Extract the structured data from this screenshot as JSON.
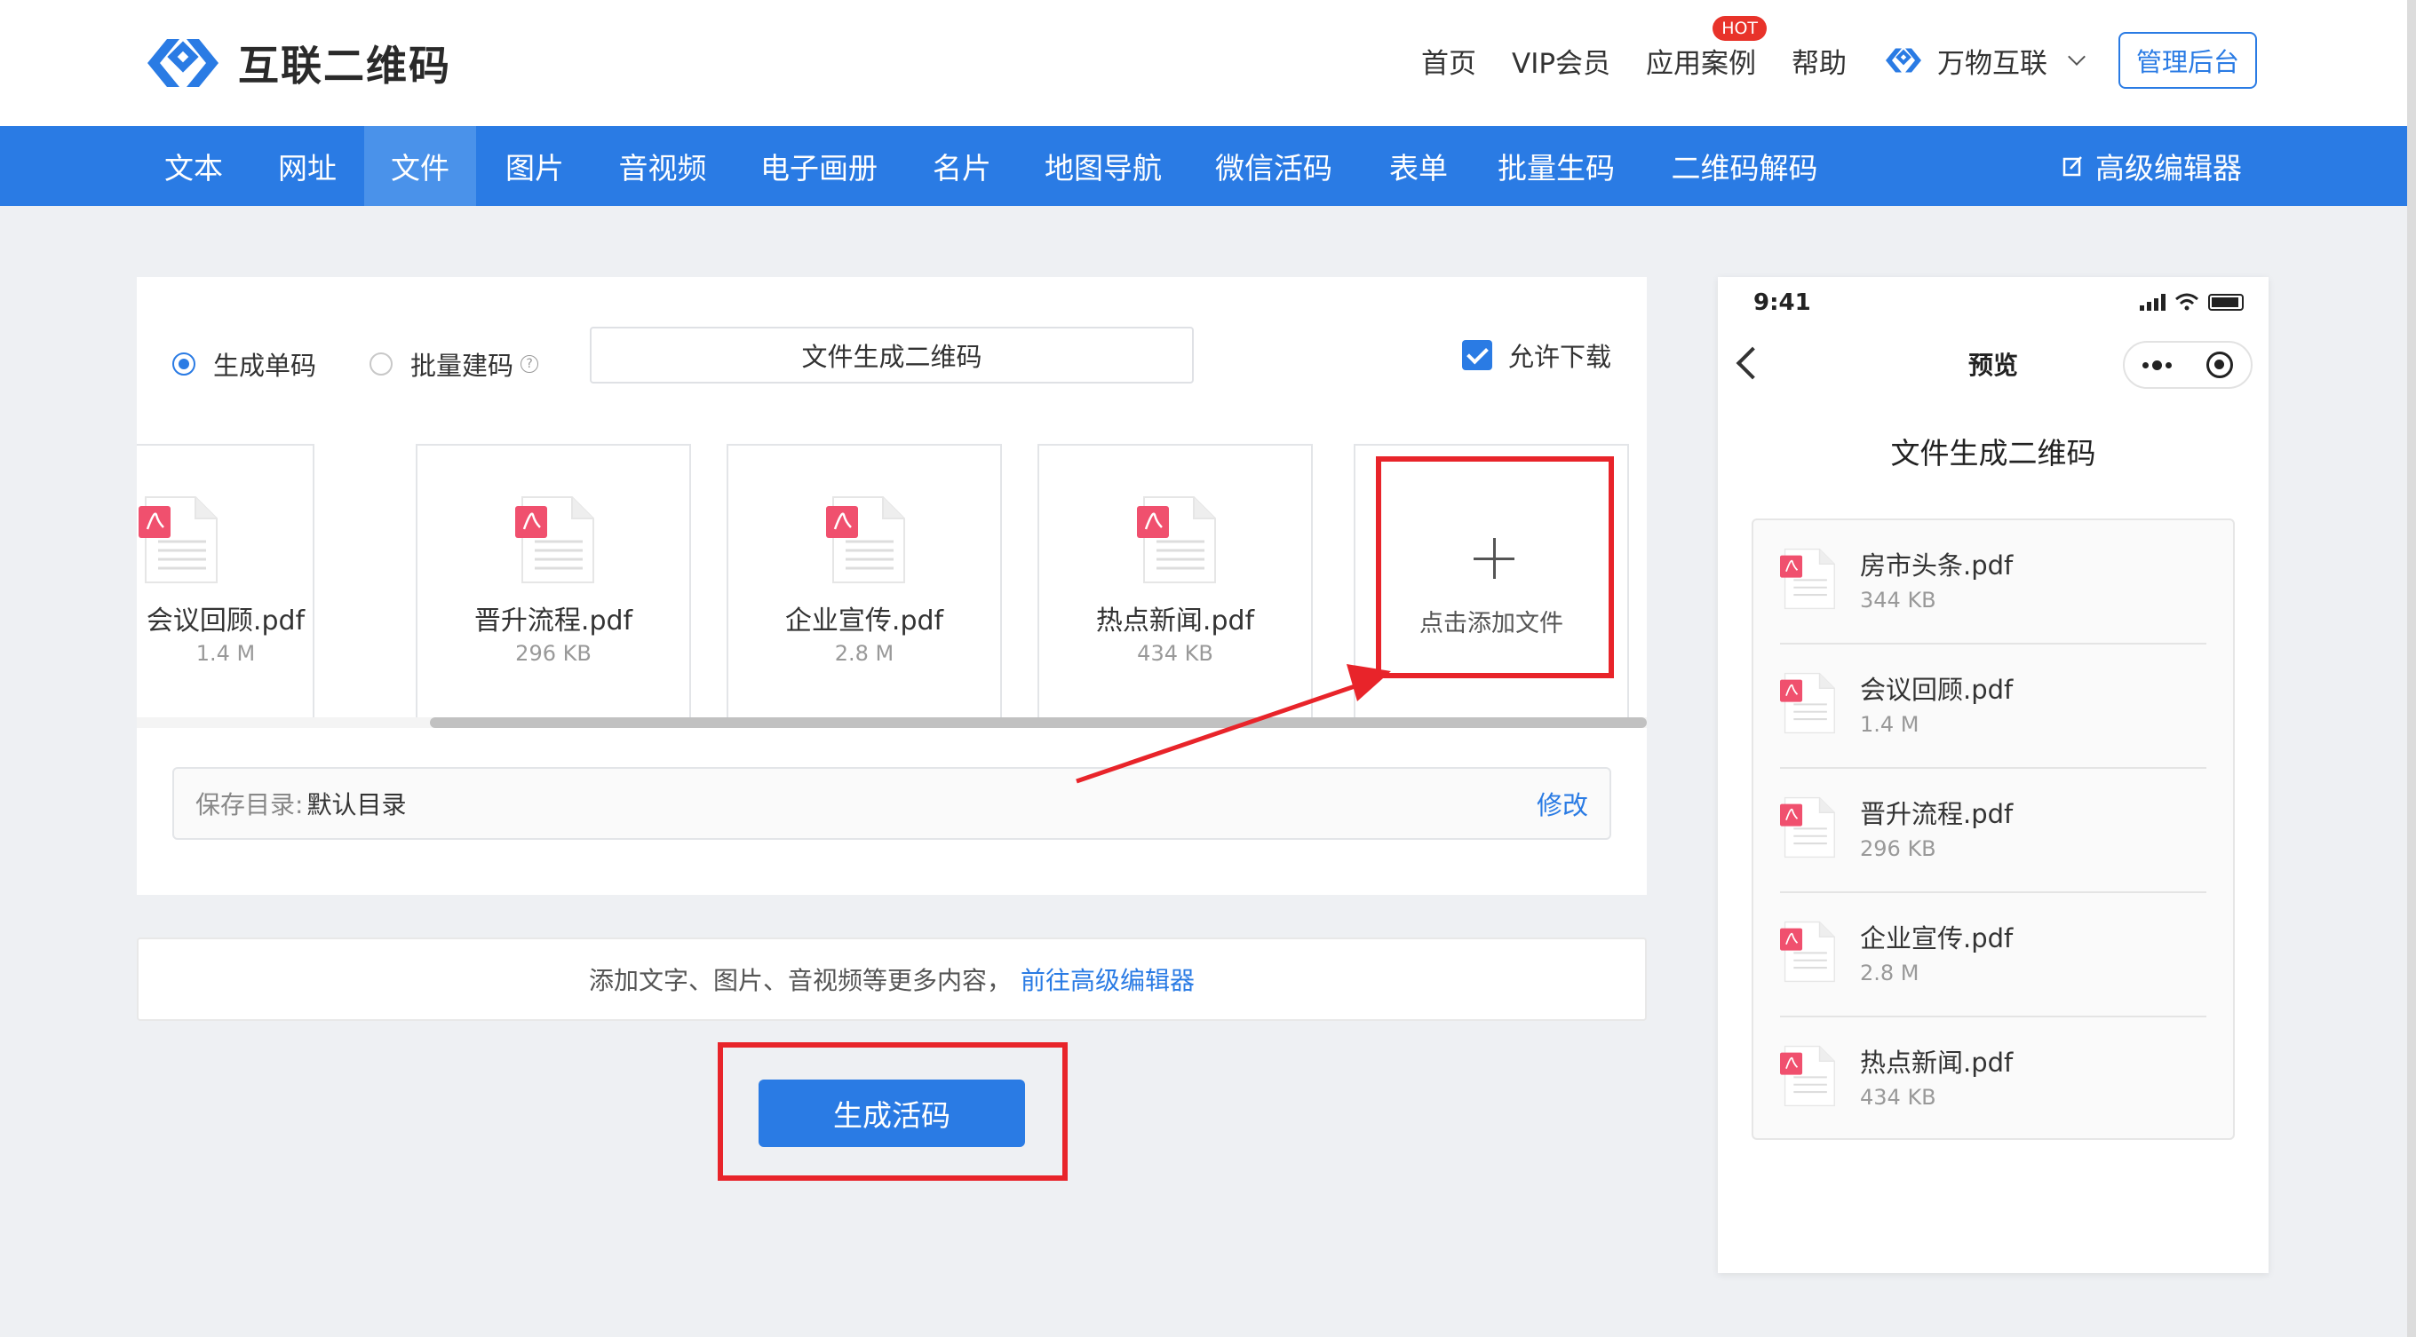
{
  "header": {
    "logo_text": "互联二维码",
    "nav": [
      "首页",
      "VIP会员",
      "应用案例",
      "帮助"
    ],
    "hot_badge": "HOT",
    "brand2": "万物互联",
    "admin_button": "管理后台"
  },
  "tabs": [
    "文本",
    "网址",
    "文件",
    "图片",
    "音视频",
    "电子画册",
    "名片",
    "地图导航",
    "微信活码",
    "表单",
    "批量生码",
    "二维码解码"
  ],
  "active_tab": "文件",
  "advanced_editor": "高级编辑器",
  "form": {
    "mode_single": "生成单码",
    "mode_batch": "批量建码",
    "title_value": "文件生成二维码",
    "allow_download": "允许下载",
    "files": [
      {
        "name": "会议回顾.pdf",
        "size": "1.4 M"
      },
      {
        "name": "晋升流程.pdf",
        "size": "296 KB"
      },
      {
        "name": "企业宣传.pdf",
        "size": "2.8 M"
      },
      {
        "name": "热点新闻.pdf",
        "size": "434 KB"
      }
    ],
    "add_file": "点击添加文件",
    "save_dir_label": "保存目录:",
    "save_dir_value": "默认目录",
    "modify": "修改"
  },
  "hint": {
    "text": "添加文字、图片、音视频等更多内容，",
    "link": "前往高级编辑器"
  },
  "generate_button": "生成活码",
  "preview": {
    "time": "9:41",
    "title": "预览",
    "heading": "文件生成二维码",
    "files": [
      {
        "name": "房市头条.pdf",
        "size": "344 KB"
      },
      {
        "name": "会议回顾.pdf",
        "size": "1.4 M"
      },
      {
        "name": "晋升流程.pdf",
        "size": "296 KB"
      },
      {
        "name": "企业宣传.pdf",
        "size": "2.8 M"
      },
      {
        "name": "热点新闻.pdf",
        "size": "434 KB"
      }
    ]
  },
  "colors": {
    "primary": "#2a7be4",
    "highlight_box": "#e8242a",
    "pdf_red": "#f0506e"
  }
}
